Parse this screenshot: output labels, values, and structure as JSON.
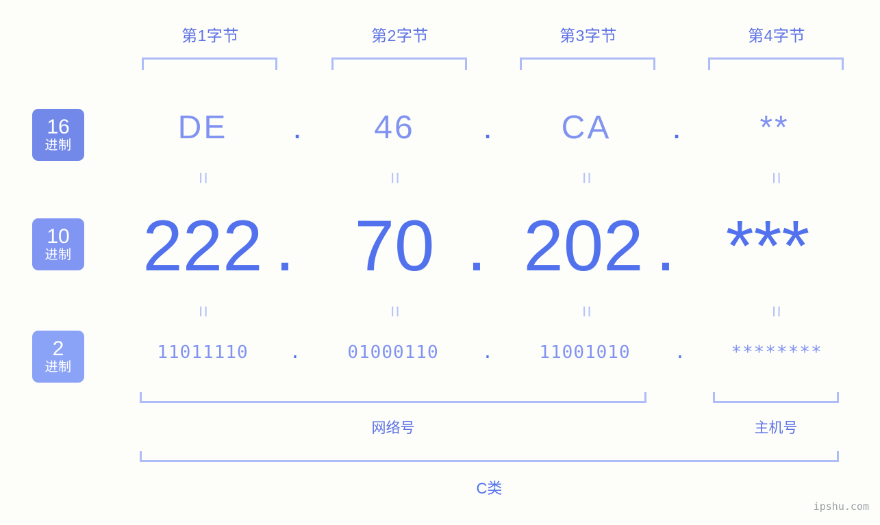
{
  "meta": {
    "watermark": "ipshu.com",
    "background_color": "#fdfefa"
  },
  "colors": {
    "accent_strong": "#5271ed",
    "accent_medium": "#5e72e4",
    "accent_light": "#8193f0",
    "bracket": "#aebcf7",
    "equals": "#b9c4f7",
    "badge_1": "#7289ea",
    "badge_2": "#8096f2",
    "badge_3": "#8ba3f7",
    "watermark": "#9aa0a6"
  },
  "byte_headers": [
    {
      "label": "第1字节"
    },
    {
      "label": "第2字节"
    },
    {
      "label": "第3字节"
    },
    {
      "label": "第4字节"
    }
  ],
  "bases": [
    {
      "num": "16",
      "unit": "进制",
      "color": "#7289ea"
    },
    {
      "num": "10",
      "unit": "进制",
      "color": "#8096f2"
    },
    {
      "num": "2",
      "unit": "进制",
      "color": "#8ba3f7"
    }
  ],
  "rows": {
    "hex": {
      "base_label": "16进制",
      "values": [
        "DE",
        "46",
        "CA",
        "**"
      ],
      "separator": "."
    },
    "decimal": {
      "base_label": "10进制",
      "values": [
        "222",
        "70",
        "202",
        "***"
      ],
      "separator": "."
    },
    "binary": {
      "base_label": "2进制",
      "values": [
        "11011110",
        "01000110",
        "11001010",
        "********"
      ],
      "separator": "."
    }
  },
  "equals_mark": "=",
  "partitions": [
    {
      "label": "网络号"
    },
    {
      "label": "主机号"
    }
  ],
  "ip_class": {
    "label": "C类"
  }
}
